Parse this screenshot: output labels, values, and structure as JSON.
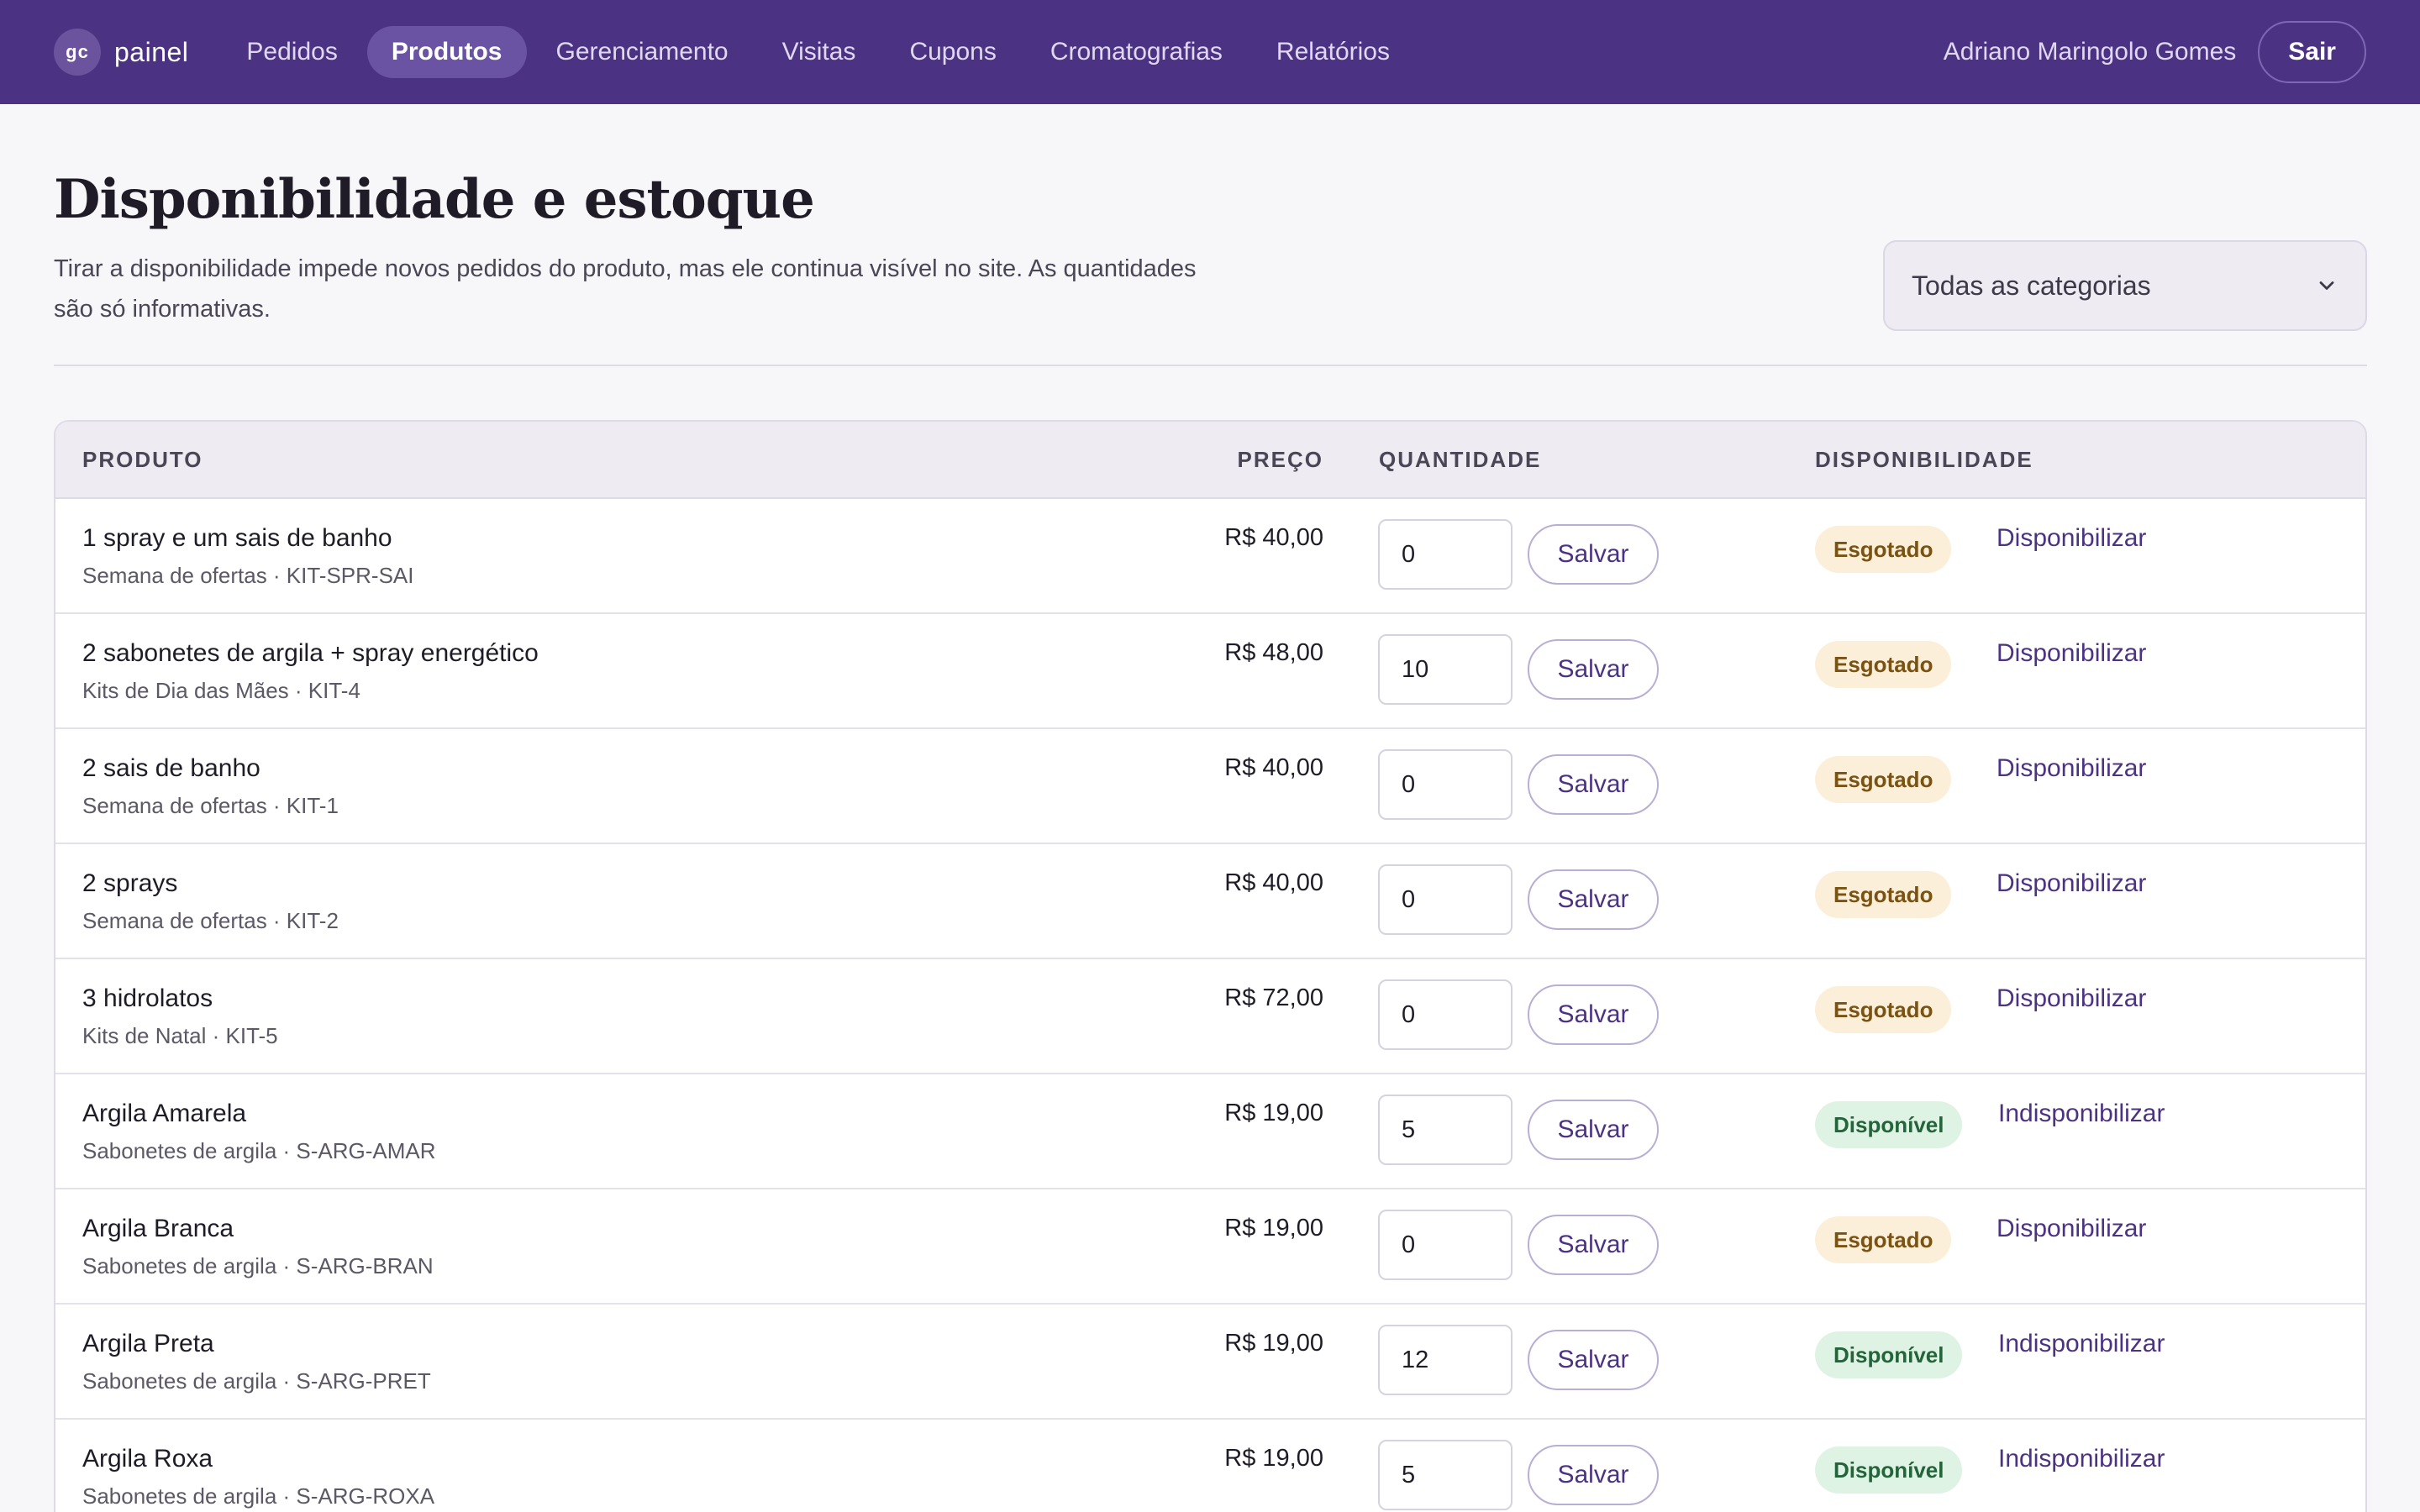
{
  "brand": {
    "badge": "gc",
    "name": "painel"
  },
  "nav": [
    {
      "label": "Pedidos",
      "active": false
    },
    {
      "label": "Produtos",
      "active": true
    },
    {
      "label": "Gerenciamento",
      "active": false
    },
    {
      "label": "Visitas",
      "active": false
    },
    {
      "label": "Cupons",
      "active": false
    },
    {
      "label": "Cromatografias",
      "active": false
    },
    {
      "label": "Relatórios",
      "active": false
    }
  ],
  "user": {
    "name": "Adriano Maringolo Gomes",
    "logout_label": "Sair"
  },
  "page": {
    "title": "Disponibilidade e estoque",
    "description": "Tirar a disponibilidade impede novos pedidos do produto, mas ele continua visível no site. As quantidades são só informativas.",
    "category_filter": "Todas as categorias"
  },
  "table": {
    "headers": {
      "product": "PRODUTO",
      "price": "PREÇO",
      "quantity": "QUANTIDADE",
      "availability": "DISPONIBILIDADE"
    },
    "save_label": "Salvar",
    "rows": [
      {
        "name": "1 spray e um sais de banho",
        "meta": "Semana de ofertas · KIT-SPR-SAI",
        "price": "R$ 40,00",
        "quantity": "0",
        "status": "Esgotado",
        "status_type": "out",
        "action": "Disponibilizar"
      },
      {
        "name": "2 sabonetes de argila + spray energético",
        "meta": "Kits de Dia das Mães · KIT-4",
        "price": "R$ 48,00",
        "quantity": "10",
        "status": "Esgotado",
        "status_type": "out",
        "action": "Disponibilizar"
      },
      {
        "name": "2 sais de banho",
        "meta": "Semana de ofertas · KIT-1",
        "price": "R$ 40,00",
        "quantity": "0",
        "status": "Esgotado",
        "status_type": "out",
        "action": "Disponibilizar"
      },
      {
        "name": "2 sprays",
        "meta": "Semana de ofertas · KIT-2",
        "price": "R$ 40,00",
        "quantity": "0",
        "status": "Esgotado",
        "status_type": "out",
        "action": "Disponibilizar"
      },
      {
        "name": "3 hidrolatos",
        "meta": "Kits de Natal · KIT-5",
        "price": "R$ 72,00",
        "quantity": "0",
        "status": "Esgotado",
        "status_type": "out",
        "action": "Disponibilizar"
      },
      {
        "name": "Argila Amarela",
        "meta": "Sabonetes de argila · S-ARG-AMAR",
        "price": "R$ 19,00",
        "quantity": "5",
        "status": "Disponível",
        "status_type": "in",
        "action": "Indisponibilizar"
      },
      {
        "name": "Argila Branca",
        "meta": "Sabonetes de argila · S-ARG-BRAN",
        "price": "R$ 19,00",
        "quantity": "0",
        "status": "Esgotado",
        "status_type": "out",
        "action": "Disponibilizar"
      },
      {
        "name": "Argila Preta",
        "meta": "Sabonetes de argila · S-ARG-PRET",
        "price": "R$ 19,00",
        "quantity": "12",
        "status": "Disponível",
        "status_type": "in",
        "action": "Indisponibilizar"
      },
      {
        "name": "Argila Roxa",
        "meta": "Sabonetes de argila · S-ARG-ROXA",
        "price": "R$ 19,00",
        "quantity": "5",
        "status": "Disponível",
        "status_type": "in",
        "action": "Indisponibilizar"
      }
    ]
  },
  "icons": {
    "category_dropdown": "chevron-down-icon"
  },
  "colors": {
    "brand": "#4c3283",
    "badge_out_bg": "#fcefd9",
    "badge_out_text": "#7a5212",
    "badge_in_bg": "#dff3e4",
    "badge_in_text": "#24643a"
  }
}
